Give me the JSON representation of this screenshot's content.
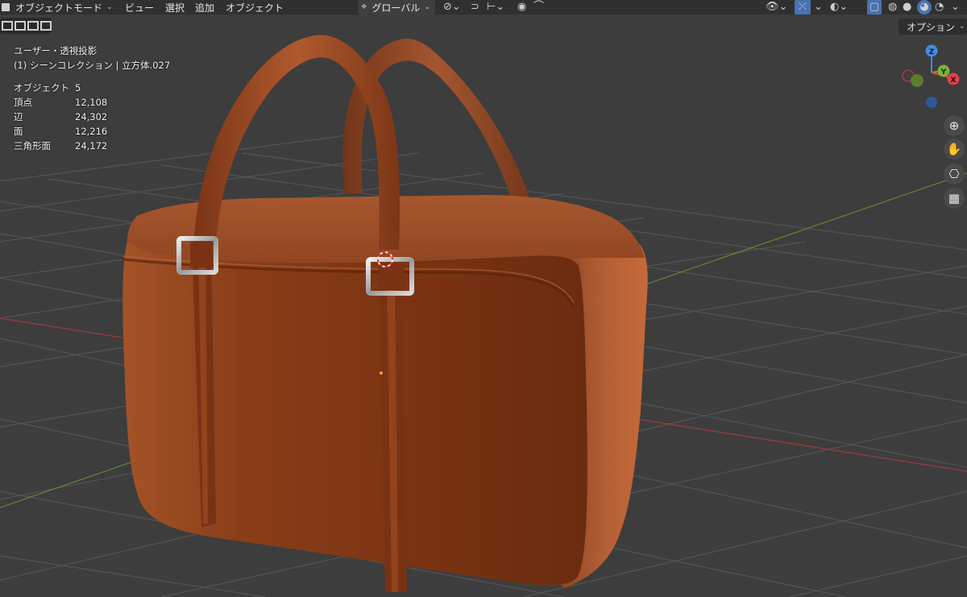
{
  "header": {
    "mode_label": "オブジェクトモード",
    "menus": [
      "ビュー",
      "選択",
      "追加",
      "オブジェクト"
    ],
    "transform_orientation": "グローバル",
    "options_label": "オプション"
  },
  "overlay": {
    "view_name": "ユーザー・透視投影",
    "collection_line": "(1) シーンコレクション | 立方体.027",
    "stats": [
      {
        "label": "オブジェクト",
        "value": "5"
      },
      {
        "label": "頂点",
        "value": "12,108"
      },
      {
        "label": "辺",
        "value": "24,302"
      },
      {
        "label": "面",
        "value": "12,216"
      },
      {
        "label": "三角形面",
        "value": "24,172"
      }
    ]
  },
  "gizmo": {
    "z_label": "Z",
    "y_label": "Y",
    "x_label": "X",
    "colors": {
      "x": "#e0404f",
      "y": "#7ab233",
      "z": "#3f8de0"
    }
  },
  "nav_icons": [
    "zoom-icon",
    "hand-pan-icon",
    "camera-icon",
    "grid-view-icon"
  ],
  "colors": {
    "viewport_bg": "#3d3d3d",
    "header_bg": "#303030",
    "bag_main": "#8a3f1a"
  }
}
